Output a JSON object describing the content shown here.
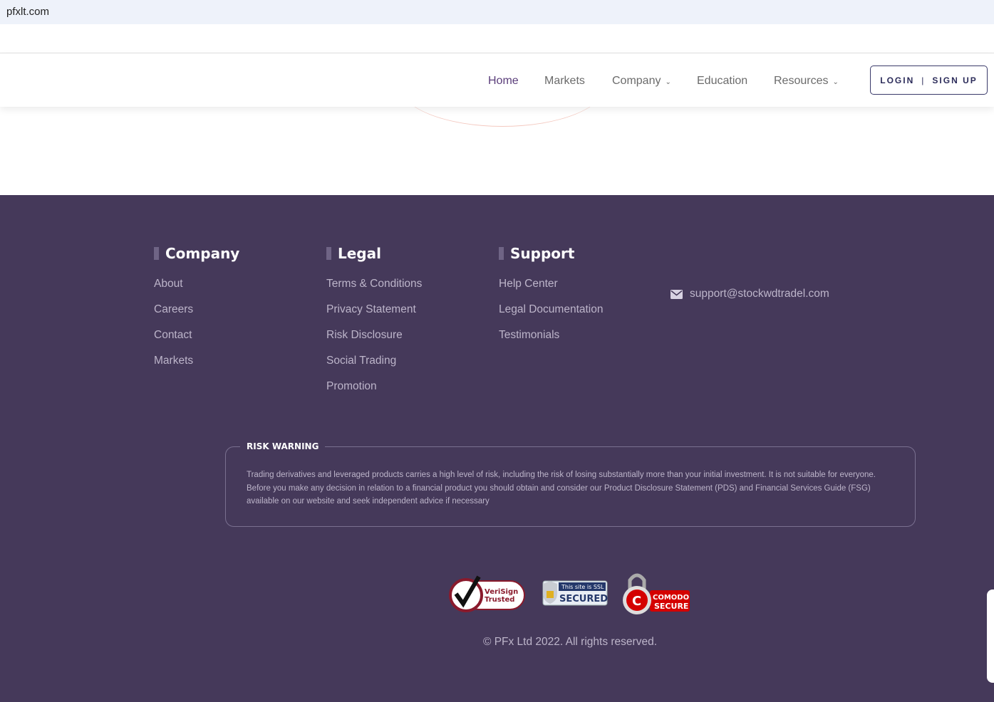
{
  "browser": {
    "url": "pfxlt.com"
  },
  "nav": {
    "items": [
      {
        "label": "Home",
        "active": true
      },
      {
        "label": "Markets"
      },
      {
        "label": "Company",
        "dropdown": true
      },
      {
        "label": "Education"
      },
      {
        "label": "Resources",
        "dropdown": true
      }
    ],
    "login": "LOGIN",
    "sep": "|",
    "signup": "SIGN UP"
  },
  "footer": {
    "company": {
      "title": "Company",
      "links": [
        "About",
        "Careers",
        "Contact",
        "Markets"
      ]
    },
    "legal": {
      "title": "Legal",
      "links": [
        "Terms & Conditions",
        "Privacy Statement",
        "Risk Disclosure",
        "Social Trading",
        "Promotion"
      ]
    },
    "support": {
      "title": "Support",
      "links": [
        "Help Center",
        "Legal Documentation",
        "Testimonials"
      ]
    },
    "email": "support@stockwdtradel.com",
    "risk": {
      "title": "RISK WARNING",
      "text": "Trading derivatives and leveraged products carries a high level of risk, including the risk of losing substantially more than your initial investment. It is not suitable for everyone. Before you make any decision in relation to a financial product you should obtain and consider our Product Disclosure Statement (PDS) and Financial Services Guide (FSG) available on our website and seek independent advice if necessary"
    },
    "badges": {
      "verisign": [
        "VeriSign",
        "Trusted"
      ],
      "ssl": [
        "This site is SSL",
        "SECURED"
      ],
      "comodo": [
        "COMODO",
        "SECURE"
      ]
    },
    "copyright": "© PFx Ltd 2022. All rights reserved."
  },
  "colors": {
    "footer_bg": "#45395a",
    "accent": "#5a3d7a"
  }
}
